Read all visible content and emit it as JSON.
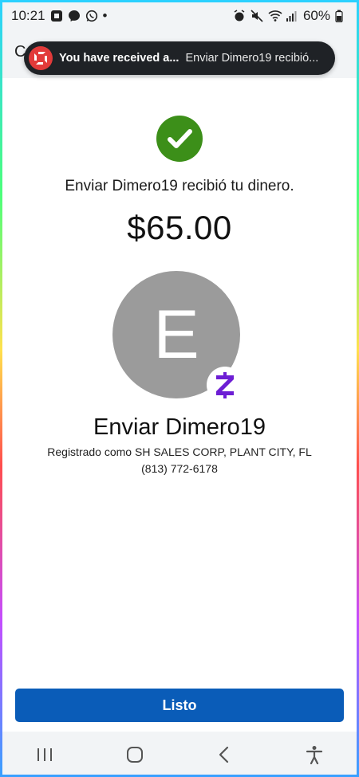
{
  "status_bar": {
    "time": "10:21",
    "dot": "•",
    "battery": "60%",
    "left_icons": [
      "chase-icon",
      "messenger-icon",
      "whatsapp-icon"
    ],
    "right_icons": [
      "alarm-icon",
      "mute-icon",
      "wifi-icon",
      "signal-icon",
      "battery-icon"
    ]
  },
  "header": {
    "partial_letter": "C"
  },
  "notification": {
    "title": "You have received a...",
    "text": "Enviar Dimero19 recibió...",
    "app_icon": "chase-icon",
    "accent_color": "#e23a3a"
  },
  "confirmation": {
    "message": "Enviar Dimero19 recibió tu dinero.",
    "amount": "$65.00",
    "check_color": "#3c8f19"
  },
  "recipient": {
    "avatar_initial": "E",
    "name": "Enviar Dimero19",
    "registration": "Registrado como SH SALES CORP, PLANT CITY, FL",
    "phone": "(813) 772-6178",
    "badge": "zelle-icon",
    "badge_color": "#6d1ed4"
  },
  "actions": {
    "done_label": "Listo",
    "done_color": "#0a5cb8"
  },
  "nav_bar": {
    "items": [
      "recent-apps-icon",
      "home-icon",
      "back-icon",
      "accessibility-icon"
    ]
  }
}
